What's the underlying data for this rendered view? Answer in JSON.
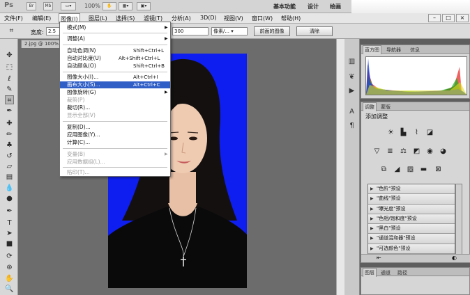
{
  "appbar": {
    "logo": "Ps",
    "btn_br": "Br",
    "btn_mb": "Mb",
    "zoom": "100%",
    "workspace_basic": "基本功能",
    "workspace_design": "设计",
    "workspace_paint": "绘画"
  },
  "menubar": {
    "items": [
      "文件(F)",
      "编辑(E)",
      "图像(I)",
      "图层(L)",
      "选择(S)",
      "滤镜(T)",
      "分析(A)",
      "3D(D)",
      "视图(V)",
      "窗口(W)",
      "帮助(H)"
    ],
    "win_min": "–",
    "win_max": "□",
    "win_close": "×"
  },
  "options": {
    "width_label": "宽度:",
    "width_value": "2.5",
    "height_value": "300",
    "unit": "像素/...",
    "front_image": "前面的图像",
    "clear": "清除"
  },
  "document": {
    "tab": "2.jpg @ 100%"
  },
  "image_menu": {
    "items": [
      {
        "label": "模式(M)",
        "shortcut": ""
      },
      {
        "label": "调整(A)",
        "shortcut": ""
      },
      {
        "label": "自动色调(N)",
        "shortcut": "Shift+Ctrl+L"
      },
      {
        "label": "自动对比度(U)",
        "shortcut": "Alt+Shift+Ctrl+L"
      },
      {
        "label": "自动颜色(O)",
        "shortcut": "Shift+Ctrl+B"
      },
      {
        "label": "图像大小(I)...",
        "shortcut": "Alt+Ctrl+I"
      },
      {
        "label": "画布大小(S)...",
        "shortcut": "Alt+Ctrl+C"
      },
      {
        "label": "图像旋转(G)",
        "shortcut": ""
      },
      {
        "label": "裁剪(P)",
        "shortcut": ""
      },
      {
        "label": "裁切(R)...",
        "shortcut": ""
      },
      {
        "label": "显示全部(V)",
        "shortcut": ""
      },
      {
        "label": "复制(D)...",
        "shortcut": ""
      },
      {
        "label": "应用图像(Y)...",
        "shortcut": ""
      },
      {
        "label": "计算(C)...",
        "shortcut": ""
      },
      {
        "label": "变量(B)",
        "shortcut": ""
      },
      {
        "label": "应用数据组(L)...",
        "shortcut": ""
      },
      {
        "label": "陷印(T)...",
        "shortcut": ""
      }
    ]
  },
  "histogram_panel": {
    "tabs": [
      "直方图",
      "导航器",
      "信息"
    ]
  },
  "adjustments_panel": {
    "tabs": [
      "调整",
      "蒙版"
    ],
    "title": "添加调整",
    "presets": [
      "\"色阶\"预设",
      "\"曲线\"预设",
      "\"曝光度\"预设",
      "\"色相/饱和度\"预设",
      "\"黑白\"预设",
      "\"通道混和器\"预设",
      "\"可选颜色\"预设"
    ]
  },
  "layers_panel": {
    "tabs": [
      "图层",
      "通道",
      "路径"
    ]
  },
  "colors": {
    "canvas_blue": "#0f1ef0",
    "menu_highlight": "#2f5ec6"
  }
}
